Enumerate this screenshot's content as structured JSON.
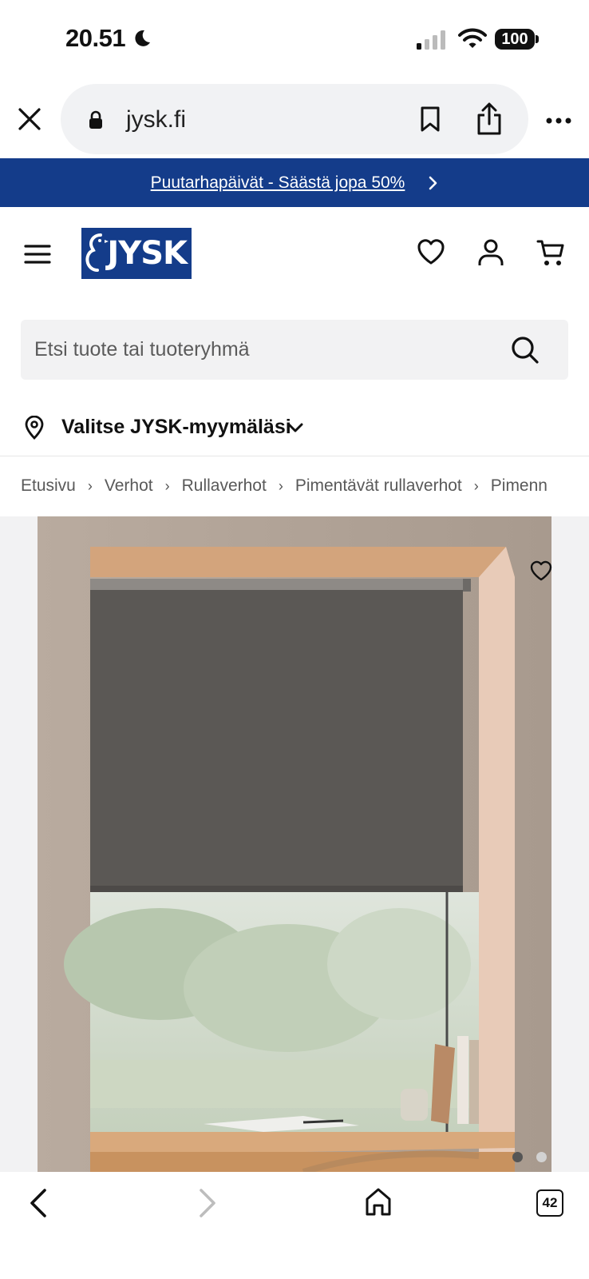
{
  "status": {
    "time": "20.51",
    "battery": "100"
  },
  "browser": {
    "url": "jysk.fi",
    "open_tabs": "42"
  },
  "banner": {
    "text": "Puutarhapäivät - Säästä jopa 50%"
  },
  "header": {
    "logo_text": "JYSK"
  },
  "search": {
    "placeholder": "Etsi tuote tai tuoteryhmä"
  },
  "store": {
    "label": "Valitse JYSK-myymäläsi"
  },
  "breadcrumbs": [
    "Etusivu",
    "Verhot",
    "Rullaverhot",
    "Pimentävät rullaverhot",
    "Pimenn"
  ],
  "gallery": {
    "image_count": 2,
    "active_index": 0
  },
  "colors": {
    "brand_blue": "#143c8a",
    "blind_gray": "#5b5855",
    "wall": "#b5a69a",
    "wood": "#d2a47a"
  }
}
